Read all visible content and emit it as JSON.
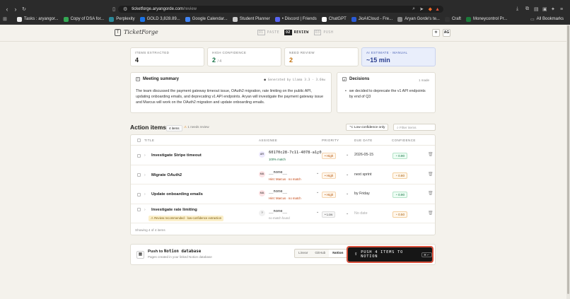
{
  "browser": {
    "url_domain": "ticketforge.aryangorde.com",
    "url_path": "/review",
    "bookmarks": [
      {
        "label": "Tasks : aryangor...",
        "color": "#e8e8e8"
      },
      {
        "label": "Copy of DSA for...",
        "color": "#34a853"
      },
      {
        "label": "Perplexity",
        "color": "#2b8a9a"
      },
      {
        "label": "GOLD 3,828.89...",
        "color": "#1a73e8"
      },
      {
        "label": "Google Calendar...",
        "color": "#4285f4"
      },
      {
        "label": "Student Planner",
        "color": "#cccccc"
      },
      {
        "label": "• Discord | Friends",
        "color": "#5865f2"
      },
      {
        "label": "ChatGPT",
        "color": "#ffffff"
      },
      {
        "label": "JioAICloud - Fre...",
        "color": "#2a5bd7"
      },
      {
        "label": "Aryan Gorde's te...",
        "color": "#888888"
      },
      {
        "label": "Craft",
        "color": "#333333"
      },
      {
        "label": "Moneycontrol Pr...",
        "color": "#1b7a3a"
      }
    ],
    "all_bookmarks": "All Bookmarks"
  },
  "app": {
    "logo_letter": "T",
    "name": "TicketForge",
    "steps": [
      {
        "num": "01",
        "label": "PASTE",
        "active": false
      },
      {
        "num": "02",
        "label": "REVIEW",
        "active": true
      },
      {
        "num": "03",
        "label": "PUSH",
        "active": false
      }
    ],
    "avatar_initials": "AG"
  },
  "stats": [
    {
      "label": "ITEMS EXTRACTED",
      "value": "4"
    },
    {
      "label": "HIGH CONFIDENCE",
      "value": "2",
      "suffix": "/ 4"
    },
    {
      "label": "NEED REVIEW",
      "value": "2"
    },
    {
      "label": "AI ESTIMATE · MANUAL",
      "value": "~15 min"
    }
  ],
  "summary": {
    "title": "Meeting summary",
    "meta": "Generated by Llama 3.3 · 3.6kw",
    "body": "The team discussed the payment gateway timeout issue, OAuth2 migration, rate limiting on the public API, updating onboarding emails, and deprecating v1 API endpoints. Aryan will investigate the payment gateway issue and Marcus will work on the OAuth2 migration and update onboarding emails."
  },
  "decisions": {
    "title": "Decisions",
    "count": "1 made",
    "items": [
      "we decided to deprecate the v1 API endpoints by end of Q3"
    ]
  },
  "action_items": {
    "title": "Action items",
    "count": "4 items",
    "needs_review": "1 needs review",
    "low_conf_toggle": "Low confidence only",
    "filter_placeholder": "Filter items",
    "columns": [
      "TITLE",
      "ASSIGNEE",
      "PRIORITY",
      "DUE DATE",
      "CONFIDENCE"
    ],
    "rows": [
      {
        "title": "Investigate Stripe timeout",
        "avatar": "AR",
        "avatar_color": "#ede9fe",
        "assignee": "60170c28-7c11-4078-a1c0...",
        "sub": "100% match",
        "sub_color": "#177245",
        "priority": "High",
        "priority_class": "high",
        "due": "2026-05-15",
        "due_empty": false,
        "confidence": "0.90",
        "conf_class": "ok",
        "warning": ""
      },
      {
        "title": "Migrate OAuth2",
        "avatar": "MA",
        "avatar_color": "#fde2e4",
        "assignee": "__none__",
        "sub": "Hint: Marcus · no match",
        "sub_color": "#c2410c",
        "priority": "High",
        "priority_class": "high",
        "due": "next sprint",
        "due_empty": false,
        "confidence": "0.80",
        "conf_class": "low",
        "warning": ""
      },
      {
        "title": "Update onboarding emails",
        "avatar": "MA",
        "avatar_color": "#fde2e4",
        "assignee": "__none__",
        "sub": "Hint: Marcus · no match",
        "sub_color": "#c2410c",
        "priority": "High",
        "priority_class": "high",
        "due": "by Friday",
        "due_empty": false,
        "confidence": "0.90",
        "conf_class": "ok",
        "warning": ""
      },
      {
        "title": "Investigate rate limiting",
        "avatar": "?",
        "avatar_color": "#f1f1f1",
        "assignee": "__none__",
        "sub": "no match found",
        "sub_color": "#999999",
        "priority": "Low",
        "priority_class": "low",
        "due": "No date",
        "due_empty": true,
        "confidence": "0.50",
        "conf_class": "low",
        "warning": "Review recommended · low-confidence extraction"
      }
    ],
    "footer": "Showing 4 of 4 items"
  },
  "push": {
    "title_prefix": "Push to",
    "title_target": "Notion database",
    "subtitle": "Pages created in your linked Notion database",
    "options": [
      {
        "label": "Linear",
        "active": false
      },
      {
        "label": "GitHub",
        "active": false
      },
      {
        "label": "Notion",
        "active": true
      }
    ],
    "button": "PUSH 4 ITEMS TO NOTION",
    "shortcut": "⌘↵"
  }
}
